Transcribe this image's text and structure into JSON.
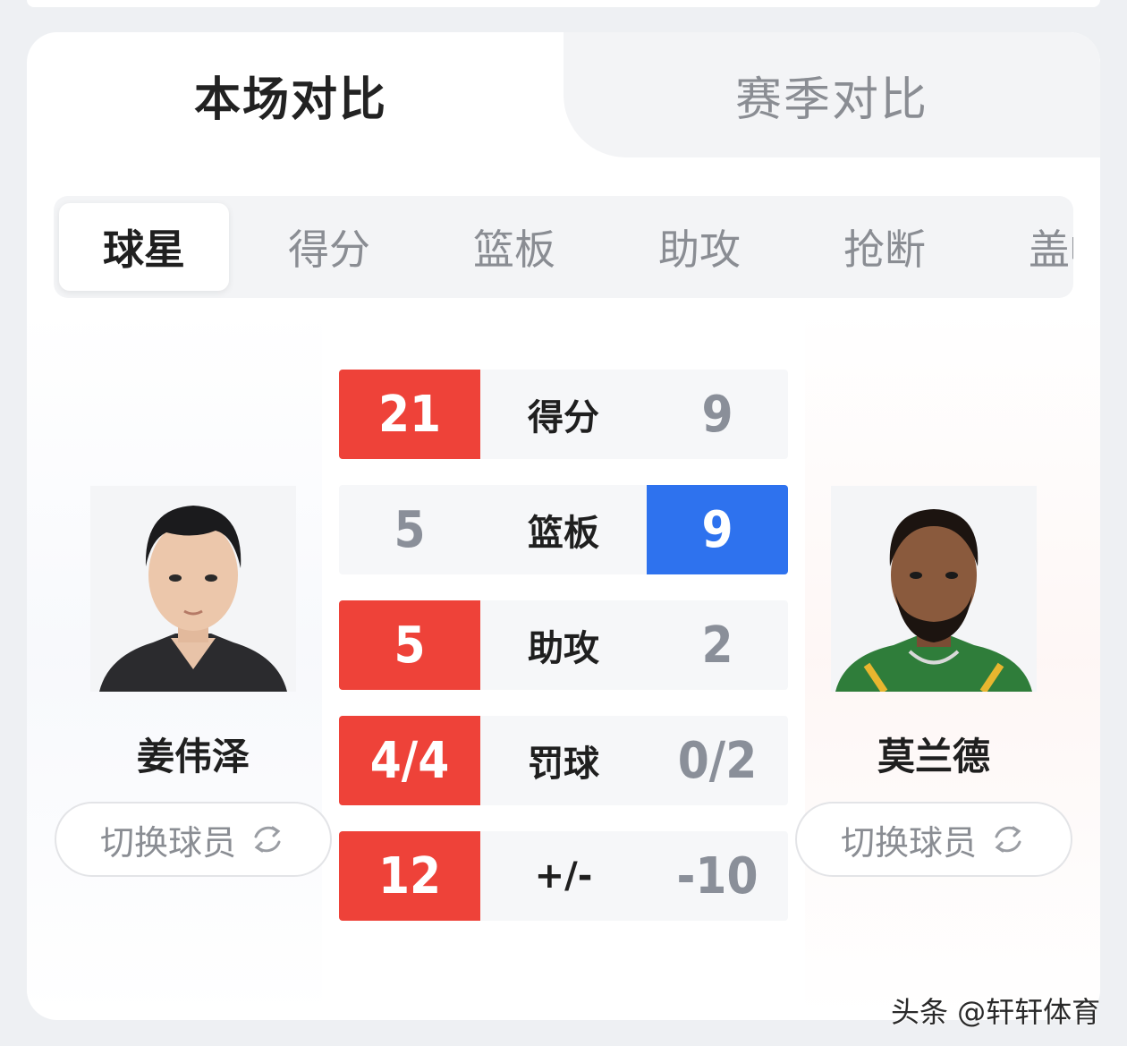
{
  "main_tabs": [
    {
      "label": "本场对比",
      "active": true
    },
    {
      "label": "赛季对比",
      "active": false
    }
  ],
  "sub_tabs": [
    {
      "label": "球星",
      "active": true
    },
    {
      "label": "得分",
      "active": false
    },
    {
      "label": "篮板",
      "active": false
    },
    {
      "label": "助攻",
      "active": false
    },
    {
      "label": "抢断",
      "active": false
    },
    {
      "label": "盖帽",
      "active": false
    }
  ],
  "left_player": {
    "name": "姜伟泽",
    "switch_label": "切换球员"
  },
  "right_player": {
    "name": "莫兰德",
    "switch_label": "切换球员"
  },
  "stats": [
    {
      "label": "得分",
      "left": "21",
      "right": "9",
      "leader": "left"
    },
    {
      "label": "篮板",
      "left": "5",
      "right": "9",
      "leader": "right"
    },
    {
      "label": "助攻",
      "left": "5",
      "right": "2",
      "leader": "left"
    },
    {
      "label": "罚球",
      "left": "4/4",
      "right": "0/2",
      "leader": "left"
    },
    {
      "label": "+/-",
      "left": "12",
      "right": "-10",
      "leader": "left"
    }
  ],
  "colors": {
    "leader_left": "#ee4239",
    "leader_right": "#2e72ee",
    "muted": "#8a8f99"
  },
  "watermark": "头条 @轩轩体育"
}
